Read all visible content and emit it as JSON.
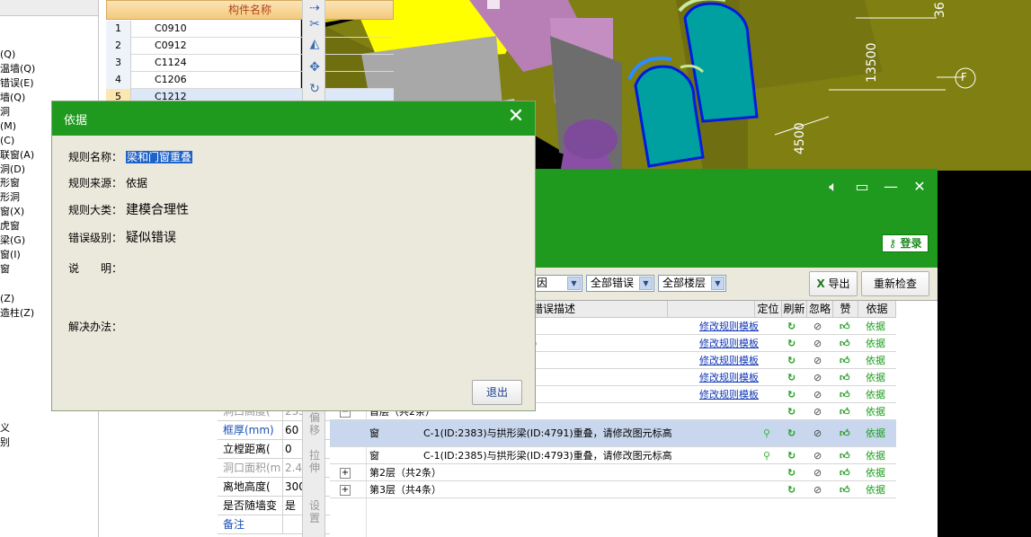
{
  "member_table": {
    "header": "构件名称",
    "rows": [
      {
        "num": "1",
        "name": "C0910"
      },
      {
        "num": "2",
        "name": "C0912"
      },
      {
        "num": "3",
        "name": "C1124"
      },
      {
        "num": "4",
        "name": "C1206"
      },
      {
        "num": "5",
        "name": "C1212"
      }
    ]
  },
  "tree": {
    "items": [
      "(Q)",
      "温墙(Q)",
      "错误(E)",
      "墙(Q)",
      "洞",
      "(M)",
      "(C)",
      "联窗(A)",
      "洞(D)",
      "形窗",
      "形洞",
      "窗(X)",
      "虎窗",
      "梁(G)",
      "窗(I)",
      "窗",
      "(Z)",
      "造柱(Z)",
      "义",
      "别"
    ]
  },
  "props": [
    {
      "key": "洞口高度(",
      "value": "2350",
      "gray": true
    },
    {
      "key": "框厚(mm)",
      "value": "60",
      "blue": true
    },
    {
      "key": "立樘距离(",
      "value": "0"
    },
    {
      "key": "洞口面积(m",
      "value": "2.455",
      "gray": true
    },
    {
      "key": "离地高度(",
      "value": "300"
    },
    {
      "key": "是否随墙变",
      "value": "是"
    },
    {
      "key": "备注",
      "value": "",
      "blue": true
    }
  ],
  "side_tool": {
    "labels": [
      "偏移",
      "拉伸",
      "设置"
    ]
  },
  "viewport": {
    "dim1": "13500",
    "dim2": "4500",
    "dim3": "36",
    "axis": "F"
  },
  "dialog": {
    "title": "依据",
    "rule_name_label": "规则名称：",
    "rule_name": "梁和门窗重叠",
    "rule_source_label": "规则来源：",
    "rule_source": "依据",
    "category_label": "规则大类：",
    "category": "建模合理性",
    "level_label": "错误级别：",
    "level": "疑似错误",
    "desc_label": "说　　明：",
    "solution_label": "解决办法：",
    "exit": "退出"
  },
  "check_window": {
    "login": "登录",
    "filter1": "因",
    "filter2": "全部错误",
    "filter3": "全部楼层",
    "export": "导出",
    "recheck": "重新检查",
    "cols": {
      "desc": "错误描述",
      "locate": "定位",
      "refresh": "刷新",
      "ignore": "忽略",
      "like": "赞",
      "basis": "依据"
    },
    "template_link": "修改规则模板",
    "basis": "依据",
    "rows": [
      {
        "type": "link",
        "extra": ""
      },
      {
        "type": "link",
        "extra": ")"
      },
      {
        "type": "link",
        "extra": ""
      },
      {
        "type": "link",
        "extra": ""
      },
      {
        "type": "link",
        "extra": ""
      },
      {
        "type": "group",
        "label": "首层（共2条）"
      },
      {
        "type": "item",
        "kind": "窗",
        "desc": "C-1(ID:2383)与拱形梁(ID:4791)重叠，请修改图元标高",
        "sel": true
      },
      {
        "type": "item",
        "kind": "窗",
        "desc": "C-1(ID:2385)与拱形梁(ID:4793)重叠，请修改图元标高"
      },
      {
        "type": "group",
        "label": "第2层（共2条）"
      },
      {
        "type": "group",
        "label": "第3层（共4条）"
      }
    ]
  }
}
